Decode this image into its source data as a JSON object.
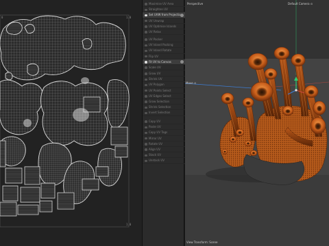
{
  "uv_editor": {
    "corner_top_left": "0",
    "corner_top_right": "1.0",
    "corner_bottom_right": "1.0"
  },
  "tools": {
    "group1": [
      {
        "label": "Maximise UV Area",
        "active": false
      },
      {
        "label": "Straighten UV",
        "active": false
      },
      {
        "label": "Set UVW from Projection",
        "active": true,
        "end_button": true
      },
      {
        "label": "UV Unwrap",
        "active": false
      },
      {
        "label": "UV Optimise Islands",
        "active": false
      },
      {
        "label": "UV Relax",
        "active": false
      }
    ],
    "group2": [
      {
        "label": "UV Packer",
        "active": false
      },
      {
        "label": "UV Island Packing",
        "active": false
      },
      {
        "label": "UV Island Rotate",
        "active": false
      },
      {
        "label": "Flip UV",
        "active": false
      },
      {
        "label": "Fit UV to Canvas",
        "active": true,
        "end_button": true
      },
      {
        "label": "Scale UV",
        "active": false
      }
    ],
    "group3": [
      {
        "label": "Grow UV",
        "active": false
      },
      {
        "label": "Shrink UV",
        "active": false
      },
      {
        "label": "UV Polygon",
        "active": false
      },
      {
        "label": "UV Points Select",
        "active": false
      },
      {
        "label": "UV Edges Select",
        "active": false
      },
      {
        "label": "Grow Selection",
        "active": false
      },
      {
        "label": "Shrink Selection",
        "active": false
      },
      {
        "label": "Invert Selection",
        "active": false
      }
    ],
    "group4": [
      {
        "label": "Copy UV",
        "active": false
      },
      {
        "label": "Paste UV",
        "active": false
      },
      {
        "label": "Copy UV Tags",
        "active": false
      },
      {
        "label": "Mirror UV",
        "active": false
      },
      {
        "label": "Rotate UV",
        "active": false
      },
      {
        "label": "Align UV",
        "active": false
      },
      {
        "label": "Stack UV",
        "active": false
      },
      {
        "label": "Unstack UV",
        "active": false
      }
    ]
  },
  "viewport": {
    "view_name": "Perspective",
    "camera_name": "Default Camera",
    "camera_suffix": "⊙",
    "move_label": "Move",
    "move_suffix": "⊙",
    "bottom_label": "View Transform: Scene"
  },
  "colors": {
    "accent_green": "#2ecc71",
    "axis_blue": "#3d7fd9",
    "axis_red": "#d0463c",
    "model_orange": "#d7691f"
  }
}
